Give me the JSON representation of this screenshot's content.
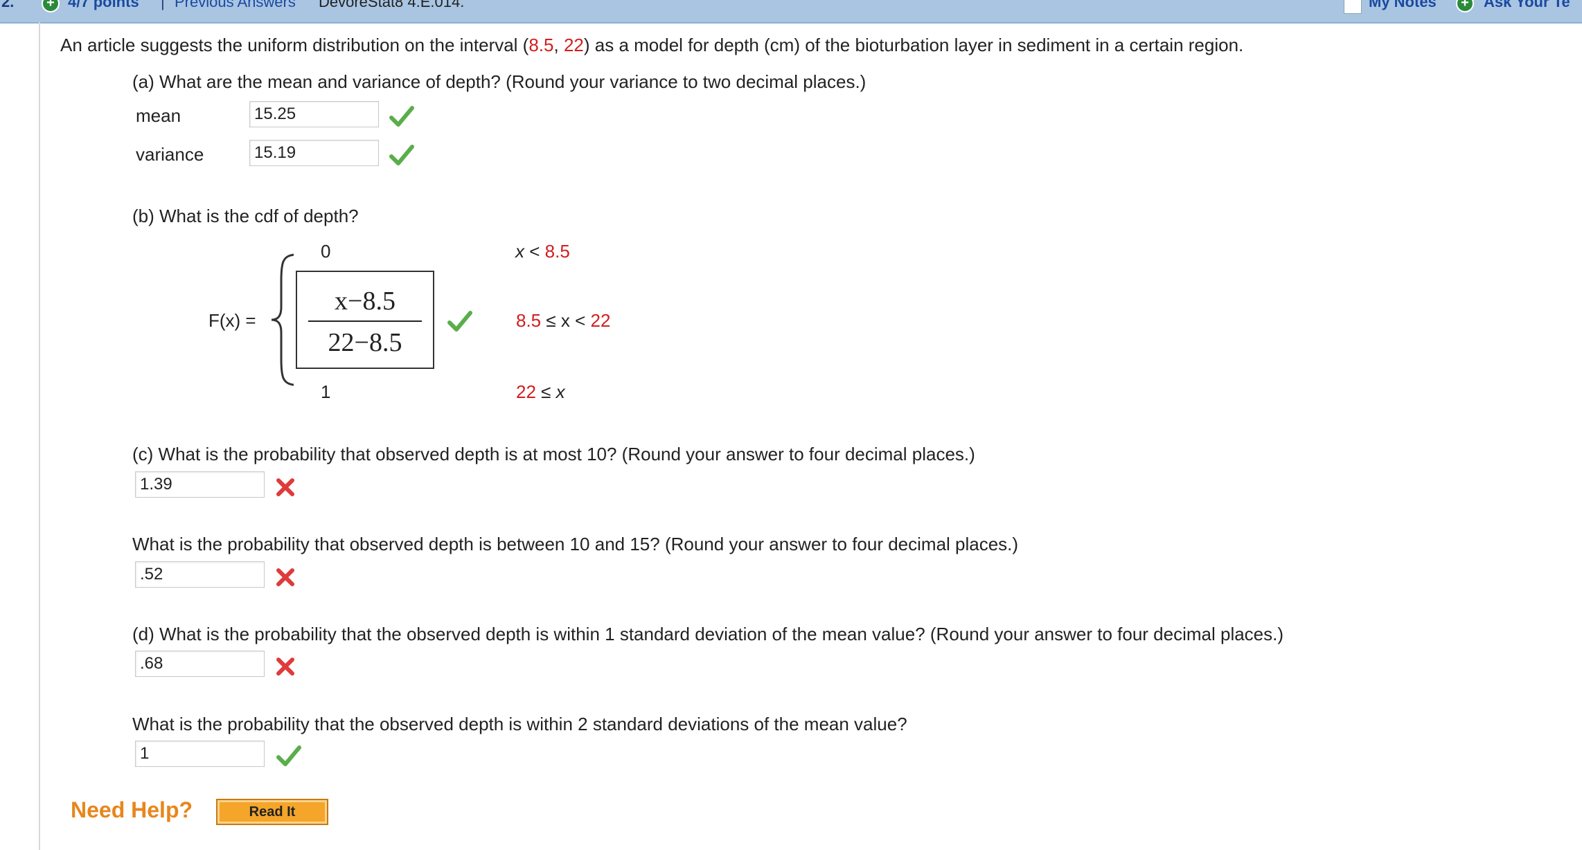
{
  "header": {
    "question_number": "2.",
    "points": "4/7 points",
    "separator": "|",
    "previous_answers": "Previous Answers",
    "source": "DevoreStat8 4.E.014.",
    "my_notes": "My Notes",
    "ask": "Ask Your Te"
  },
  "intro": {
    "prefix": "An article suggests the uniform distribution on the interval (",
    "a": "8.5",
    "comma": ", ",
    "b": "22",
    "suffix": ") as a model for depth (cm) of the bioturbation layer in sediment in a certain region."
  },
  "part_a": {
    "question": "(a) What are the mean and variance of depth? (Round your variance to two decimal places.)",
    "mean_label": "mean",
    "mean_value": "15.25",
    "variance_label": "variance",
    "variance_value": "15.19"
  },
  "part_b": {
    "question": "(b) What is the cdf of depth?",
    "fx_label": "F(x) =",
    "row1_value": "0",
    "row1_var": "x",
    "row1_cond": " < ",
    "row1_bound": "8.5",
    "numerator": "x−8.5",
    "denominator": "22−8.5",
    "row2_lower": "8.5",
    "row2_middle": " ≤ x < ",
    "row2_upper": "22",
    "row3_value": "1",
    "row3_bound": "22",
    "row3_cond": " ≤ ",
    "row3_var": "x"
  },
  "part_c": {
    "question": "(c) What is the probability that observed depth is at most 10? (Round your answer to four decimal places.)",
    "answer": "1.39",
    "question2": "What is the probability that observed depth is between 10 and 15? (Round your answer to four decimal places.)",
    "answer2": ".52"
  },
  "part_d": {
    "question": "(d) What is the probability that the observed depth is within 1 standard deviation of the mean value? (Round your answer to four decimal places.)",
    "answer": ".68",
    "question2": "What is the probability that the observed depth is within 2 standard deviations of the mean value?",
    "answer2": "1"
  },
  "help": {
    "need_help": "Need Help?",
    "read_it": "Read It"
  },
  "colors": {
    "accent_red": "#d21e1e",
    "check_green": "#5aae4a",
    "x_red": "#e03a3a",
    "help_orange": "#e8861c"
  }
}
